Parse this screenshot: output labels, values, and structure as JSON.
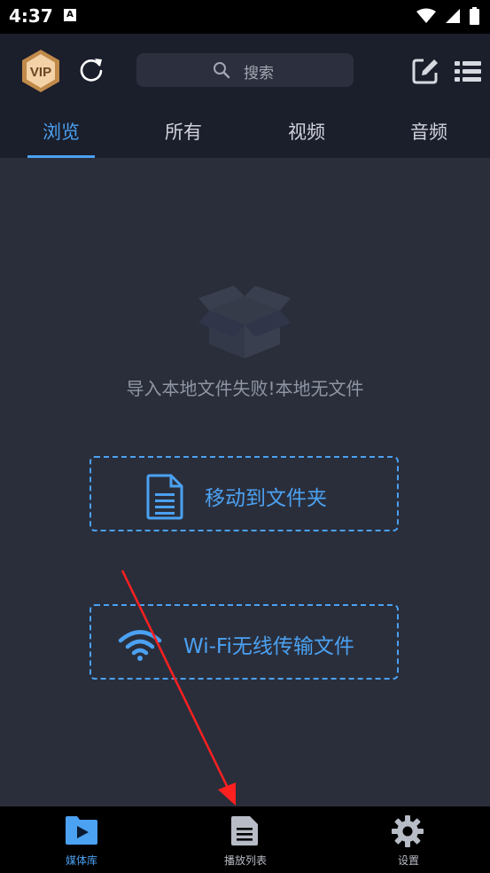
{
  "status_bar": {
    "time": "4:37",
    "notification_icon": "A",
    "wifi_icon": "wifi-icon",
    "signal_icon": "signal-icon",
    "battery_icon": "battery-icon"
  },
  "header": {
    "vip_label": "VIP",
    "search_placeholder": "搜索"
  },
  "tabs": [
    {
      "label": "浏览",
      "active": true
    },
    {
      "label": "所有",
      "active": false
    },
    {
      "label": "视频",
      "active": false
    },
    {
      "label": "音频",
      "active": false
    }
  ],
  "empty_state": {
    "icon": "empty-box-icon",
    "message": "导入本地文件失败!本地无文件"
  },
  "actions": {
    "move_to_folder": "移动到文件夹",
    "wifi_transfer": "Wi-Fi无线传输文件"
  },
  "bottom_nav": [
    {
      "label": "媒体库",
      "icon": "media-folder-icon",
      "active": true
    },
    {
      "label": "播放列表",
      "icon": "playlist-icon",
      "active": false
    },
    {
      "label": "设置",
      "icon": "gear-icon",
      "active": false
    }
  ],
  "colors": {
    "accent": "#4ba1f2",
    "background": "#2a2e3b",
    "header": "#1b1e2b",
    "annotation_arrow": "#ff2020"
  }
}
